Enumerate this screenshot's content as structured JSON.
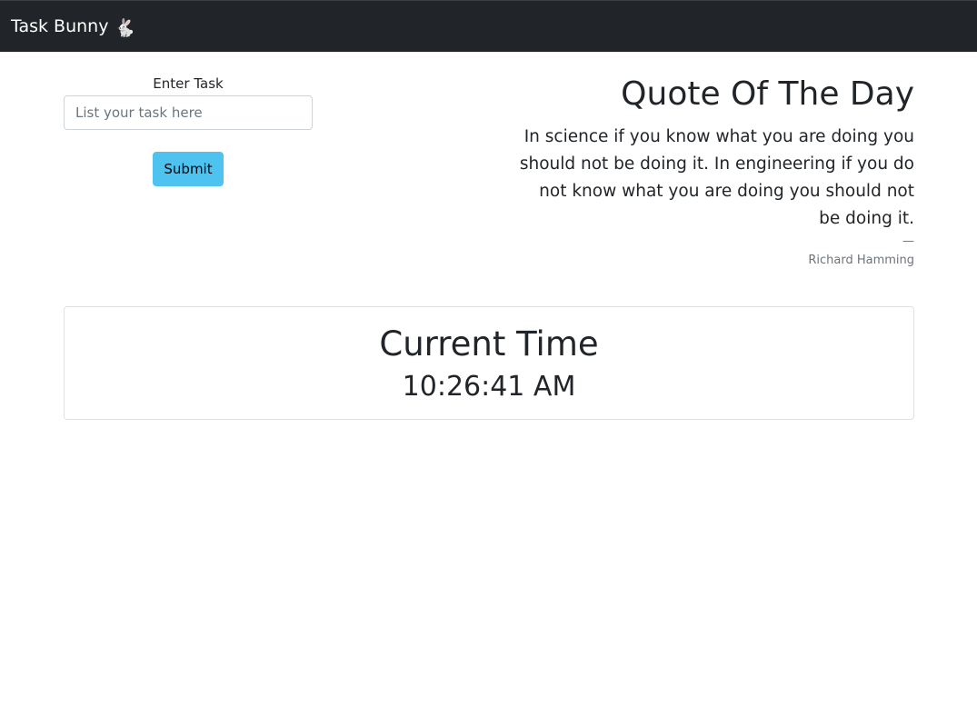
{
  "navbar": {
    "brand": "Task Bunny",
    "brand_emoji": "🐇"
  },
  "task_form": {
    "label": "Enter Task",
    "placeholder": "List your task here",
    "value": "",
    "submit_label": "Submit"
  },
  "quote": {
    "title": "Quote Of The Day",
    "text": "In science if you know what you are doing you should not be doing it. In engineering if you do not know what you are doing you should not be doing it.",
    "dash": "—",
    "author": "Richard Hamming"
  },
  "clock": {
    "title": "Current Time",
    "time": "10:26:41 AM"
  },
  "colors": {
    "navbar_bg": "#212529",
    "submit_bg": "#4fc3f0",
    "text": "#212529",
    "muted": "#6c757d"
  }
}
